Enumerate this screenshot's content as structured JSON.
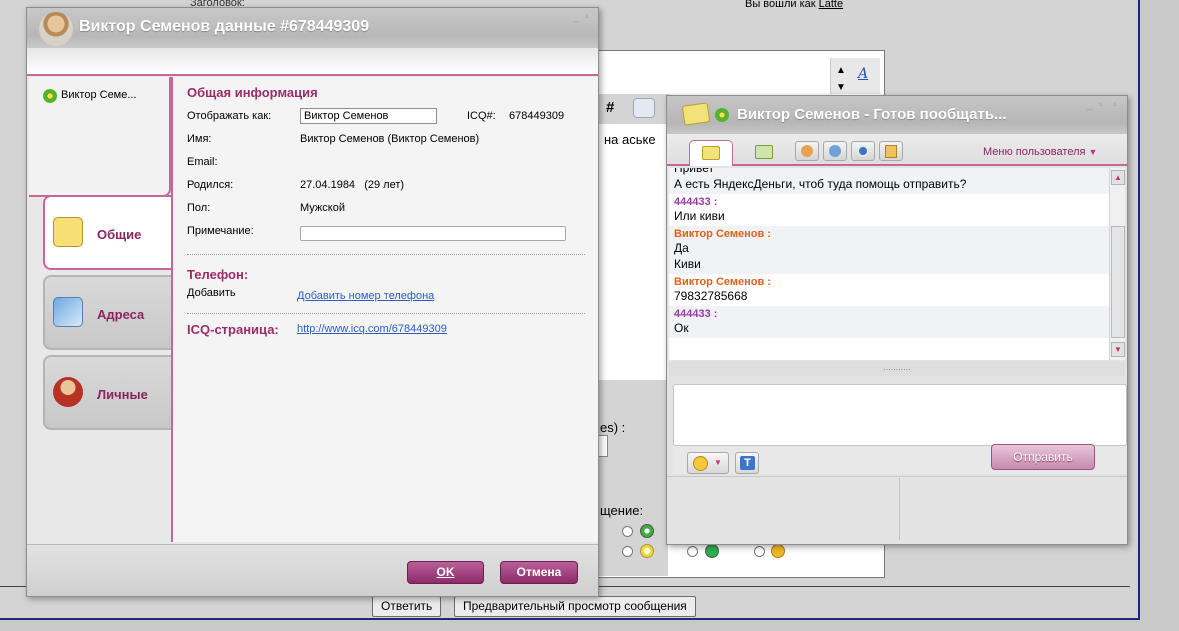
{
  "background": {
    "header_label": "Заголовок:",
    "logged_in_text": "Вы вошли как",
    "logged_in_user": "Latte",
    "hash_symbol": "#",
    "partial_text_icq": "на аське",
    "partial_text_es": "es) :",
    "partial_text_notice": "щение:",
    "reply_button": "Ответить",
    "preview_button": "Предварительный просмотр сообщения",
    "arrow_up": "▲",
    "arrow_down": "▼"
  },
  "details_window": {
    "title": "Виктор Семенов данные #678449309",
    "contact_name": "Виктор Семе...",
    "tabs": [
      {
        "label": "Общие",
        "icon": "id-card-icon"
      },
      {
        "label": "Адреса",
        "icon": "address-card-icon"
      },
      {
        "label": "Личные",
        "icon": "person-icon"
      }
    ],
    "general": {
      "section_title": "Общая информация",
      "display_as_label": "Отображать как:",
      "display_as_value": "Виктор Семенов",
      "icq_label": "ICQ#:",
      "icq_value": "678449309",
      "name_label": "Имя:",
      "name_value": "Виктор  Семенов (Виктор Семенов)",
      "email_label": "Email:",
      "born_label": "Родился:",
      "born_value": "27.04.1984   (29 лет)",
      "gender_label": "Пол:",
      "gender_value": "Мужской",
      "note_label": "Примечание:",
      "note_value": ""
    },
    "phone": {
      "section_title": "Телефон:",
      "add_label": "Добавить",
      "add_link": "Добавить номер телефона"
    },
    "icq_page": {
      "section_title": "ICQ-страница:",
      "url": "http://www.icq.com/678449309"
    },
    "ok_button": "OK",
    "cancel_button": "Отмена"
  },
  "chat_window": {
    "title": "Виктор Семенов - Готов пообщать...",
    "user_menu": "Меню пользователя",
    "messages": [
      {
        "sender": "",
        "lines": [
          "Привет",
          "А есть ЯндексДеньги, чтоб туда помощь отправить?"
        ],
        "me": false
      },
      {
        "sender": "444433 :",
        "lines": [
          "Или киви"
        ],
        "me": true
      },
      {
        "sender": "Виктор Семенов :",
        "lines": [
          "Да",
          "Киви"
        ],
        "me": false
      },
      {
        "sender": "Виктор Семенов :",
        "lines": [
          "79832785668"
        ],
        "me": false
      },
      {
        "sender": "444433 :",
        "lines": [
          "Ок"
        ],
        "me": true
      }
    ],
    "send_button": "Отправить",
    "splitter": "...........",
    "input_value": ""
  },
  "colors": {
    "accent": "#9b2c6a",
    "tab_border": "#c6679a",
    "my_name": "#9b3aa8",
    "their_name": "#e0601b",
    "link": "#2e5cc2"
  }
}
